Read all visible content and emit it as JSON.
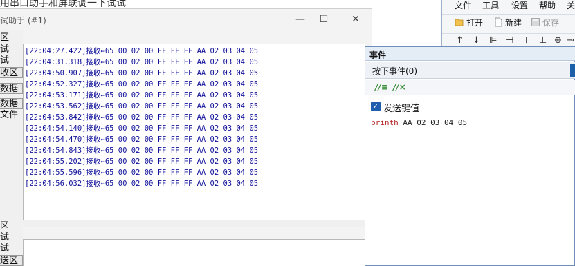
{
  "doc_title": "用串口助手和屏联调一下试试",
  "serial_window": {
    "title": "试助手 (#1)",
    "minimize_glyph": "—",
    "maximize_glyph": "☐",
    "close_glyph": "✕",
    "left_items": [
      "区",
      "试",
      "试",
      "收区",
      "数据",
      "数据",
      "文件",
      "区",
      "试",
      "试",
      "送区"
    ],
    "log": [
      {
        "ts": "[22:04:27.422]",
        "dir": "接收←",
        "hex": "65 00 02 00 FF FF FF AA 02 03 04 05"
      },
      {
        "ts": "[22:04:31.318]",
        "dir": "接收←",
        "hex": "65 00 02 00 FF FF FF AA 02 03 04 05"
      },
      {
        "ts": "[22:04:50.907]",
        "dir": "接收←",
        "hex": "65 00 02 00 FF FF FF AA 02 03 04 05"
      },
      {
        "ts": "[22:04:52.327]",
        "dir": "接收←",
        "hex": "65 00 02 00 FF FF FF AA 02 03 04 05"
      },
      {
        "ts": "[22:04:53.171]",
        "dir": "接收←",
        "hex": "65 00 02 00 FF FF FF AA 02 03 04 05"
      },
      {
        "ts": "[22:04:53.562]",
        "dir": "接收←",
        "hex": "65 00 02 00 FF FF FF AA 02 03 04 05"
      },
      {
        "ts": "[22:04:53.842]",
        "dir": "接收←",
        "hex": "65 00 02 00 FF FF FF AA 02 03 04 05"
      },
      {
        "ts": "[22:04:54.140]",
        "dir": "接收←",
        "hex": "65 00 02 00 FF FF FF AA 02 03 04 05"
      },
      {
        "ts": "[22:04:54.470]",
        "dir": "接收←",
        "hex": "65 00 02 00 FF FF FF AA 02 03 04 05"
      },
      {
        "ts": "[22:04:54.843]",
        "dir": "接收←",
        "hex": "65 00 02 00 FF FF FF AA 02 03 04 05"
      },
      {
        "ts": "[22:04:55.202]",
        "dir": "接收←",
        "hex": "65 00 02 00 FF FF FF AA 02 03 04 05"
      },
      {
        "ts": "[22:04:55.596]",
        "dir": "接收←",
        "hex": "65 00 02 00 FF FF FF AA 02 03 04 05"
      },
      {
        "ts": "[22:04:56.032]",
        "dir": "接收←",
        "hex": "65 00 02 00 FF FF FF AA 02 03 04 05"
      }
    ]
  },
  "app": {
    "menu": [
      "文件",
      "工具",
      "设置",
      "帮助",
      "关"
    ],
    "toolbar": [
      {
        "label": "打开",
        "icon": "folder-open-icon"
      },
      {
        "label": "新建",
        "icon": "new-file-icon"
      },
      {
        "label": "保存",
        "icon": "save-icon"
      }
    ],
    "toolbar2_symbols": [
      "↑",
      "↓",
      "⊫",
      "⊣",
      "⊤",
      "⊥",
      "⊕",
      "⊸"
    ]
  },
  "event_panel": {
    "title": "事件",
    "selected_event": "按下事件(0)",
    "tool_icons": [
      "//≡",
      "//×"
    ],
    "checkbox_label": "发送键值",
    "checkbox_checked": true,
    "code_keyword": "printh",
    "code_args": "AA 02 03 04 05"
  },
  "colors": {
    "log_text": "#10109a",
    "keyword": "#b22222",
    "accent": "#1f5fad"
  }
}
